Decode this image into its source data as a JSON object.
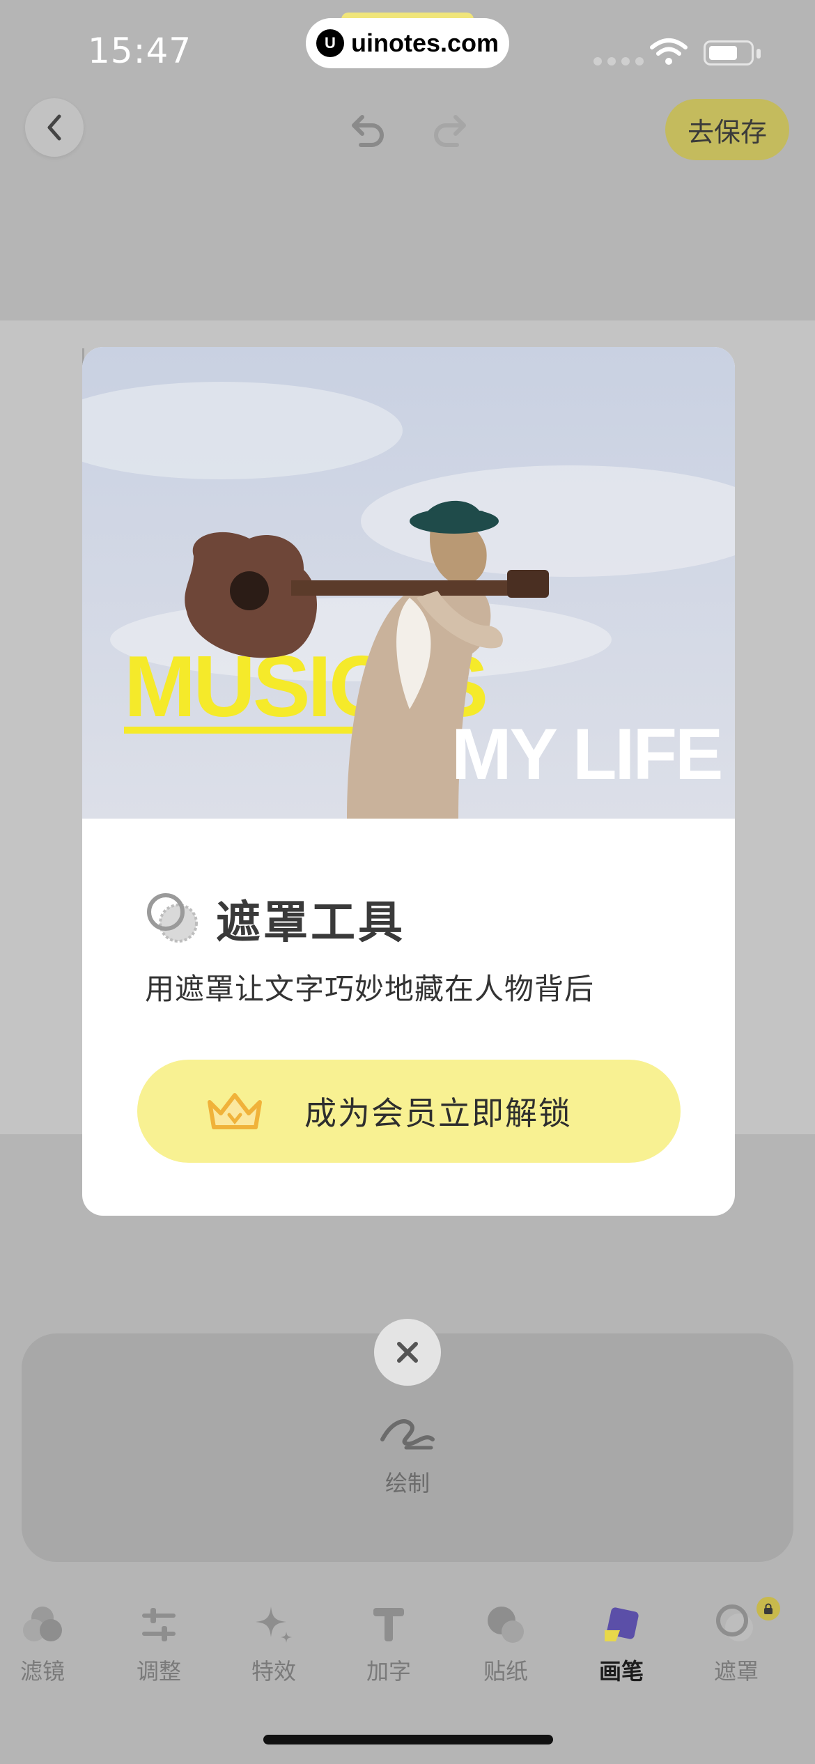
{
  "status_bar": {
    "time": "15:47",
    "watermark": "uinotes.com"
  },
  "toolbar": {
    "save_label": "去保存"
  },
  "modal": {
    "title": "遮罩工具",
    "subtitle": "用遮罩让文字巧妙地藏在人物背后",
    "unlock_label": "成为会员立即解锁",
    "photo_text_line1": "MUSIC IS",
    "photo_text_line2": "MY LIFE"
  },
  "brush_panel": {
    "items": [
      {
        "label": "绘制",
        "icon": "brush-stroke-icon"
      }
    ]
  },
  "tabs": [
    {
      "label": "滤镜",
      "icon": "filter-icon"
    },
    {
      "label": "调整",
      "icon": "adjust-icon"
    },
    {
      "label": "特效",
      "icon": "sparkle-icon"
    },
    {
      "label": "加字",
      "icon": "text-icon"
    },
    {
      "label": "贴纸",
      "icon": "sticker-icon"
    },
    {
      "label": "画笔",
      "icon": "brush-icon",
      "active": true
    },
    {
      "label": "遮罩",
      "icon": "mask-icon",
      "locked": true
    }
  ],
  "colors": {
    "accent_yellow": "#f8f192",
    "save_button": "#c4bb5d",
    "overlay": "#b5b5b5"
  }
}
